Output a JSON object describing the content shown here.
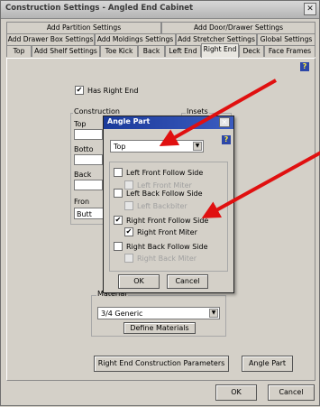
{
  "window": {
    "title": "Construction Settings - Angled End Cabinet",
    "close_glyph": "✕"
  },
  "tabs_row1": [
    "Add Partition Settings",
    "Add Door/Drawer Settings"
  ],
  "tabs_row2": [
    "Add Drawer Box Settings",
    "Add Moldings Settings",
    "Add Stretcher Settings",
    "Global Settings"
  ],
  "tabs_row3": [
    "Top",
    "Add Shelf Settings",
    "Toe Kick",
    "Back",
    "Left End",
    "Right End",
    "Deck",
    "Face Frames"
  ],
  "active_tab": "Right End",
  "help_glyph": "?",
  "has_right_end": {
    "label": "Has Right End",
    "checked": true
  },
  "construction": {
    "label": "Construction",
    "top_label": "Top",
    "bottom_label": "Botto",
    "back_label": "Back",
    "front_label": "Fron",
    "front_value": "Butt"
  },
  "insets": {
    "label": "Insets"
  },
  "material": {
    "label": "Material",
    "value": "3/4 Generic",
    "define_button": "Define Materials"
  },
  "bottom_buttons": {
    "parameters": "Right End Construction Parameters",
    "angle_part": "Angle Part"
  },
  "footer": {
    "ok": "OK",
    "cancel": "Cancel"
  },
  "angle_part_dialog": {
    "title": "Angle Part",
    "close_glyph": "✕",
    "help_glyph": "?",
    "part_select": "Top",
    "options": [
      {
        "label": "Left Front Follow Side",
        "checked": false,
        "enabled": true
      },
      {
        "label": "Left Front Miter",
        "checked": false,
        "enabled": false
      },
      {
        "label": "Left Back Follow Side",
        "checked": false,
        "enabled": true
      },
      {
        "label": "Left Backbiter",
        "checked": false,
        "enabled": false
      },
      {
        "label": "Right Front Follow Side",
        "checked": true,
        "enabled": true
      },
      {
        "label": "Right Front Miter",
        "checked": true,
        "enabled": true
      },
      {
        "label": "Right Back Follow Side",
        "checked": false,
        "enabled": true
      },
      {
        "label": "Right Back Miter",
        "checked": false,
        "enabled": false
      }
    ],
    "ok": "OK",
    "cancel": "Cancel"
  },
  "checkmark_glyph": "✔",
  "dropdown_glyph": "▼",
  "colors": {
    "arrow": "#e01010",
    "dialog_title": "#1a3a9a",
    "help_icon": "#2d47a8"
  }
}
